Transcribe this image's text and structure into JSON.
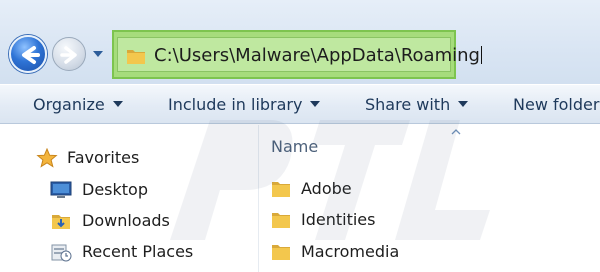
{
  "address_bar": {
    "path": "C:\\Users\\Malware\\AppData\\Roaming"
  },
  "toolbar": {
    "items": [
      {
        "label": "Organize"
      },
      {
        "label": "Include in library"
      },
      {
        "label": "Share with"
      },
      {
        "label": "New folder"
      }
    ]
  },
  "sidebar": {
    "header": "Favorites",
    "items": [
      {
        "label": "Desktop"
      },
      {
        "label": "Downloads"
      },
      {
        "label": "Recent Places"
      }
    ]
  },
  "file_list": {
    "column_header": "Name",
    "items": [
      {
        "name": "Adobe"
      },
      {
        "name": "Identities"
      },
      {
        "name": "Macromedia"
      }
    ]
  },
  "colors": {
    "address_highlight": "#a6dc7c",
    "toolbar_text": "#1e395b",
    "folder_yellow": "#f3c74d"
  }
}
